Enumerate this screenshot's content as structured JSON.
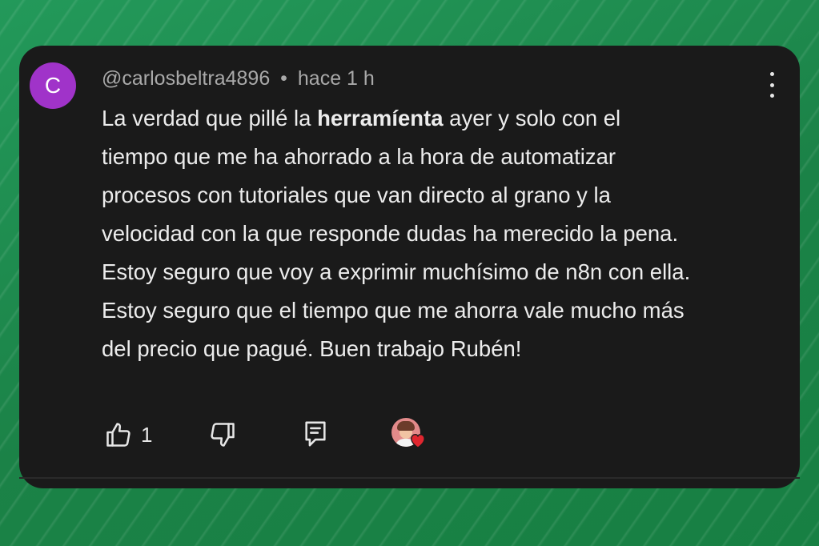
{
  "comment": {
    "avatar_letter": "C",
    "avatar_color": "#a033c9",
    "username": "@carlosbeltra4896",
    "separator": "•",
    "time_ago": "hace 1 h",
    "lines": [
      {
        "pre": "La verdad que pillé la ",
        "bold": "herramíenta",
        "post": " ayer y solo con el"
      },
      {
        "text": "tiempo que me ha ahorrado a la hora de automatizar"
      },
      {
        "text": "procesos con tutoriales que van directo al grano y la"
      },
      {
        "text": "velocidad con la que responde dudas ha merecido la pena."
      },
      {
        "text": "Estoy seguro que voy a exprimir muchísimo de n8n con ella."
      },
      {
        "text": "Estoy seguro que el tiempo que me ahorra vale mucho más"
      },
      {
        "text": "del precio que pagué. Buen trabajo Rubén!"
      }
    ],
    "like_count": "1"
  },
  "icons": {
    "like": "thumbs-up-icon",
    "dislike": "thumbs-down-icon",
    "reply": "reply-comment-icon",
    "menu": "more-vertical-icon",
    "creator_heart": "creator-heart-icon"
  },
  "colors": {
    "card_bg": "#1a1a1a",
    "text": "#ececec",
    "meta_text": "#a9a9a9",
    "heart": "#e0262f",
    "background": "#1f8a4c"
  }
}
